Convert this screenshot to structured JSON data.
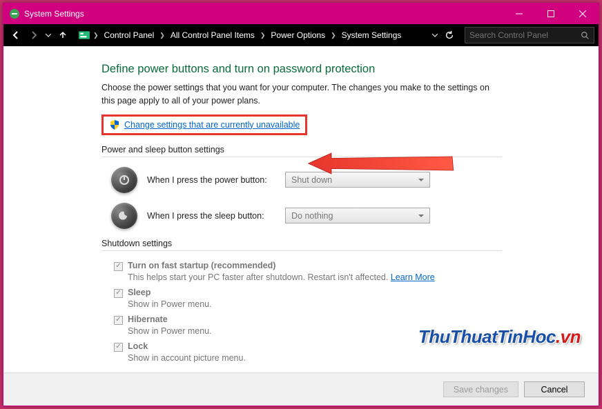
{
  "title": "System Settings",
  "breadcrumbs": [
    "Control Panel",
    "All Control Panel Items",
    "Power Options",
    "System Settings"
  ],
  "search_placeholder": "Search Control Panel",
  "heading": "Define power buttons and turn on password protection",
  "description": "Choose the power settings that you want for your computer. The changes you make to the settings on this page apply to all of your power plans.",
  "admin_link": "Change settings that are currently unavailable",
  "section_power": "Power and sleep button settings",
  "rows": {
    "power": {
      "label": "When I press the power button:",
      "value": "Shut down"
    },
    "sleep": {
      "label": "When I press the sleep button:",
      "value": "Do nothing"
    }
  },
  "section_shutdown": "Shutdown settings",
  "shutdown_items": {
    "fast": {
      "title": "Turn on fast startup (recommended)",
      "sub": "This helps start your PC faster after shutdown. Restart isn't affected. ",
      "link": "Learn More"
    },
    "sleep": {
      "title": "Sleep",
      "sub": "Show in Power menu."
    },
    "hiber": {
      "title": "Hibernate",
      "sub": "Show in Power menu."
    },
    "lock": {
      "title": "Lock",
      "sub": "Show in account picture menu."
    }
  },
  "buttons": {
    "save": "Save changes",
    "cancel": "Cancel"
  },
  "watermark": {
    "a": "ThuThuatTinHoc",
    "b": ".vn"
  }
}
